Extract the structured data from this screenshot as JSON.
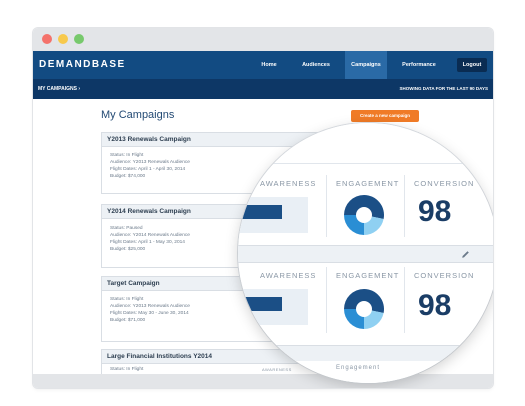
{
  "window": {
    "brand": "DEMANDBASE",
    "nav": [
      "Home",
      "Audiences",
      "Campaigns",
      "Performance"
    ],
    "active_nav": "Campaigns",
    "logout": "Logout",
    "breadcrumb": "MY CAMPAIGNS",
    "range_note": "SHOWING DATA FOR THE LAST 90 DAYS"
  },
  "page": {
    "title": "My Campaigns",
    "new_button": "Create a new campaign"
  },
  "campaigns": [
    {
      "name": "Y2013 Renewals Campaign",
      "status": "In Flight",
      "audience": "Y2013 Renewals Audience",
      "dates": "April 1 - April 30, 2014",
      "budget": "$74,000"
    },
    {
      "name": "Y2014 Renewals Campaign",
      "status": "Paused",
      "audience": "Y2014 Renewals Audience",
      "dates": "April 1 - May 30, 2014",
      "budget": "$25,000"
    },
    {
      "name": "Target Campaign",
      "status": "In Flight",
      "audience": "Y2013 Renewals Audience",
      "dates": "May 30 - June 30, 2014",
      "budget": "$71,000"
    },
    {
      "name": "Large Financial Institutions Y2014",
      "status": "In Flight",
      "audience": "",
      "dates": "",
      "budget": ""
    }
  ],
  "field_labels": {
    "status": "Status:",
    "audience": "Audience:",
    "dates": "Flight Dates:",
    "budget": "Budget:"
  },
  "metrics": {
    "awareness": "AWARENESS",
    "engagement": "ENGAGEMENT",
    "conversion": "CONVERSION",
    "conversion_value_1": "98",
    "conversion_value_2": "98",
    "engagement_small": "Engagement"
  },
  "colors": {
    "nav": "#124b82",
    "nav_active": "#2a6aa6",
    "subbar": "#0d3766",
    "accent": "#f07b27",
    "dark_blue": "#1b4f86",
    "mid_blue": "#2a8ed4",
    "light_blue": "#8fd0f2"
  }
}
